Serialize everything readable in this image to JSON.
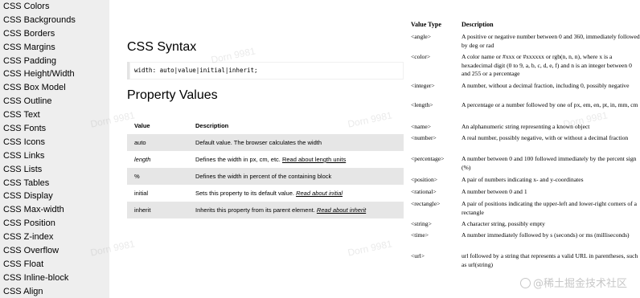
{
  "sidebar": {
    "items": [
      "CSS Colors",
      "CSS Backgrounds",
      "CSS Borders",
      "CSS Margins",
      "CSS Padding",
      "CSS Height/Width",
      "CSS Box Model",
      "CSS Outline",
      "CSS Text",
      "CSS Fonts",
      "CSS Icons",
      "CSS Links",
      "CSS Lists",
      "CSS Tables",
      "CSS Display",
      "CSS Max-width",
      "CSS Position",
      "CSS Z-index",
      "CSS Overflow",
      "CSS Float",
      "CSS Inline-block",
      "CSS Align"
    ]
  },
  "main": {
    "syntax_title": "CSS Syntax",
    "syntax_code": "width: auto|value|initial|inherit;",
    "values_title": "Property Values",
    "table": {
      "headers": [
        "Value",
        "Description"
      ],
      "rows": [
        {
          "value": "auto",
          "desc": "Default value. The browser calculates the width",
          "link": ""
        },
        {
          "value": "length",
          "desc": "Defines the width in px, cm, etc. ",
          "link": "Read about length units"
        },
        {
          "value": "%",
          "desc": "Defines the width in percent of the containing block",
          "link": ""
        },
        {
          "value": "initial",
          "desc": "Sets this property to its default value. ",
          "link": "Read about initial"
        },
        {
          "value": "inherit",
          "desc": "Inherits this property from its parent element. ",
          "link": "Read about inherit"
        }
      ]
    }
  },
  "value_types": {
    "headers": [
      "Value Type",
      "Description"
    ],
    "rows": [
      {
        "type": "<angle>",
        "desc": "A positive or negative number between 0 and 360, immediately followed by deg or rad"
      },
      {
        "type": "<color>",
        "desc": "A color name or #xxx or #xxxxxx or rgb(n, n, n), where x is a hexadecimal digit (0 to 9, a, b, c, d, e, f) and n is an integer between 0 and 255 or a percentage"
      },
      {
        "type": "<integer>",
        "desc": "A number, without a decimal fraction, including 0, possibly negative"
      },
      {
        "type": "<length>",
        "desc": "A percentage or a number followed by one of px, em, en, pt, in, mm, cm"
      },
      {
        "type": "<name>",
        "desc": "An alphanumeric string representing a known object"
      },
      {
        "type": "<number>",
        "desc": "A real number, possibly negative, with or without a decimal fraction"
      },
      {
        "type": "<percentage>",
        "desc": "A number between 0 and 100 followed immediately by the percent sign (%)"
      },
      {
        "type": "<position>",
        "desc": "A pair of numbers indicating x- and y-coordinates"
      },
      {
        "type": "<rational>",
        "desc": "A number between 0 and 1"
      },
      {
        "type": "<rectangle>",
        "desc": "A pair of positions indicating the upper-left and lower-right corners of a rectangle"
      },
      {
        "type": "<string>",
        "desc": "A character string, possibly empty"
      },
      {
        "type": "<time>",
        "desc": "A number immediately followed by s (seconds) or ms (milliseconds)"
      },
      {
        "type": "<url>",
        "desc": "url followed by a string that represents a valid URL in parentheses, such as url(string)"
      }
    ]
  },
  "watermark": "Dorn 9981",
  "brand_watermark": "@稀土掘金技术社区"
}
